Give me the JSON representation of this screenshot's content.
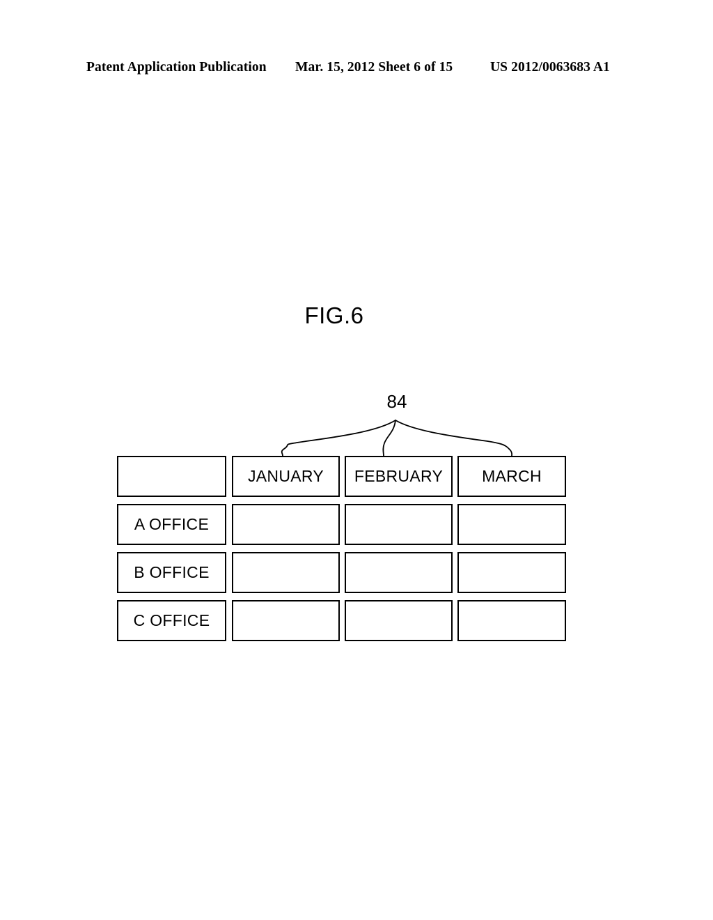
{
  "page_header": {
    "publication": "Patent Application Publication",
    "date_sheet": "Mar. 15, 2012  Sheet 6 of 15",
    "patent_number": "US 2012/0063683 A1"
  },
  "figure": {
    "title": "FIG.6",
    "reference_numeral": "84"
  },
  "table": {
    "column_headers": [
      "",
      "JANUARY",
      "FEBRUARY",
      "MARCH"
    ],
    "rows": [
      {
        "label": "A OFFICE",
        "cells": [
          "",
          "",
          ""
        ]
      },
      {
        "label": "B OFFICE",
        "cells": [
          "",
          "",
          ""
        ]
      },
      {
        "label": "C OFFICE",
        "cells": [
          "",
          "",
          ""
        ]
      }
    ]
  },
  "colors": {
    "ink": "#000000",
    "paper": "#ffffff"
  }
}
